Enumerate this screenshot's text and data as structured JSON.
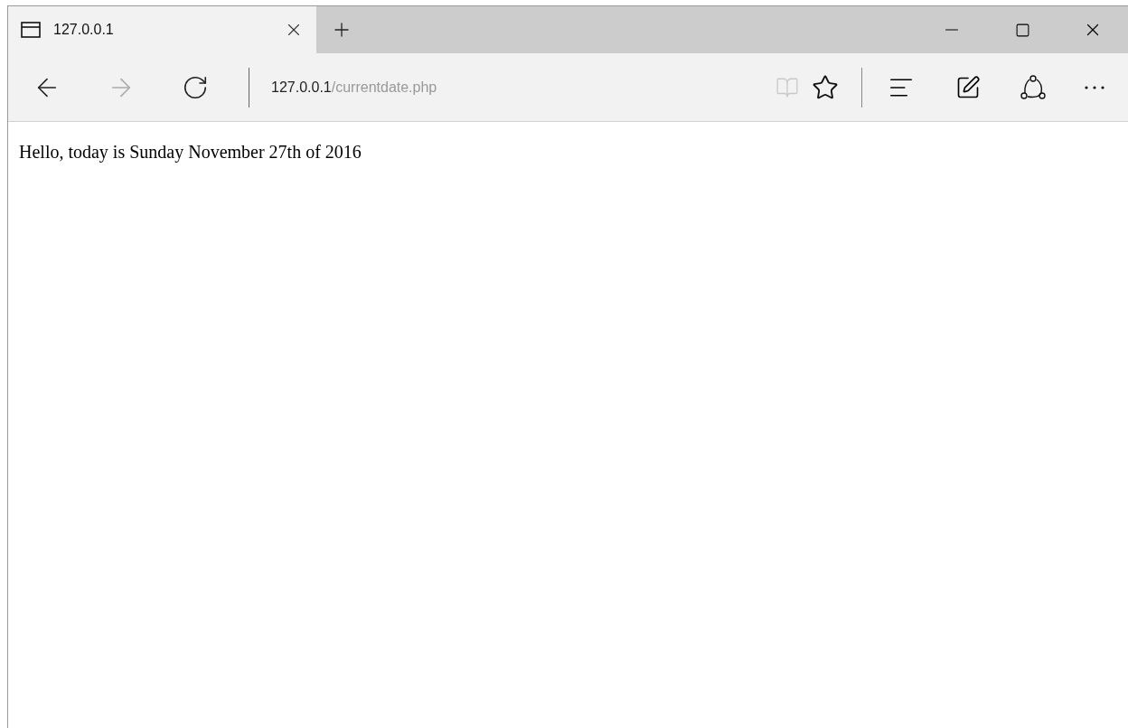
{
  "tabs": [
    {
      "title": "127.0.0.1",
      "selected": true
    }
  ],
  "toolbar": {
    "forward_disabled": true,
    "reading_view_disabled": true
  },
  "address": {
    "host": "127.0.0.1",
    "path": "/currentdate.php"
  },
  "page": {
    "text": "Hello, today is Sunday November 27th of 2016"
  }
}
